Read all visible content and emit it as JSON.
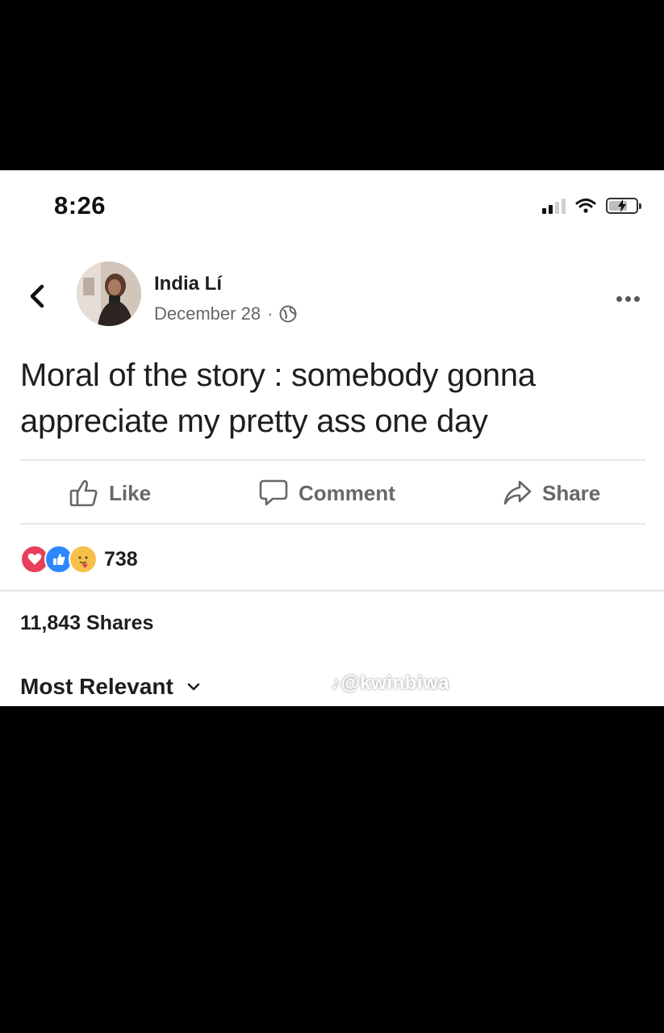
{
  "status_bar": {
    "time": "8:26"
  },
  "post": {
    "author": "India Lí",
    "date": "December 28",
    "separator": "·",
    "text_line1": "Moral of the story : somebody gonna",
    "text_line2": "appreciate my pretty ass one day"
  },
  "actions": {
    "like": "Like",
    "comment": "Comment",
    "share": "Share"
  },
  "reactions": {
    "icons": [
      "love-icon",
      "like-icon",
      "care-icon"
    ],
    "count": "738"
  },
  "shares": "11,843 Shares",
  "comments_sort": {
    "label": "Most Relevant"
  },
  "watermark": "♪@kwinbiwa",
  "colors": {
    "love": "#e8405a",
    "like": "#2d88ff",
    "care": "#f7c04a",
    "muted": "#65676b"
  }
}
